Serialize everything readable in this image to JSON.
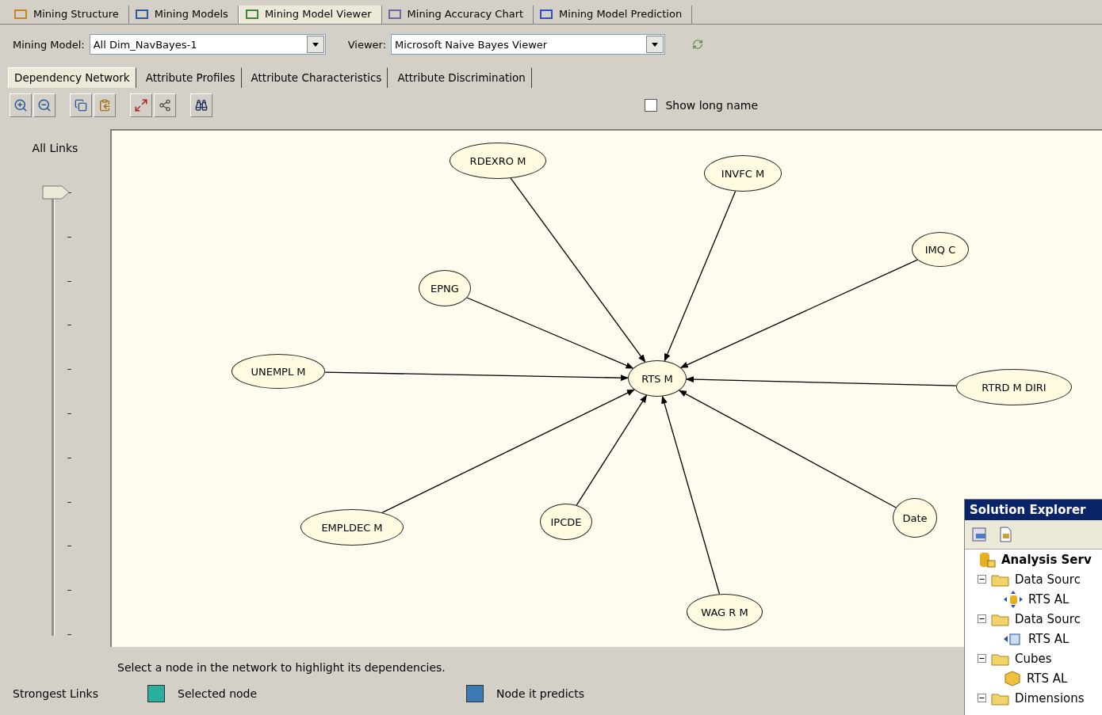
{
  "designer_tabs": [
    {
      "label": "Mining Structure",
      "selected": false
    },
    {
      "label": "Mining Models",
      "selected": false
    },
    {
      "label": "Mining Model Viewer",
      "selected": true
    },
    {
      "label": "Mining Accuracy Chart",
      "selected": false
    },
    {
      "label": "Mining Model Prediction",
      "selected": false
    }
  ],
  "mining_model": {
    "label": "Mining Model:",
    "value": "All Dim_NavBayes-1"
  },
  "viewer": {
    "label": "Viewer:",
    "value": "Microsoft Naive Bayes Viewer"
  },
  "viewer_tabs": [
    {
      "label": "Dependency Network",
      "selected": true
    },
    {
      "label": "Attribute Profiles",
      "selected": false
    },
    {
      "label": "Attribute Characteristics",
      "selected": false
    },
    {
      "label": "Attribute Discrimination",
      "selected": false
    }
  ],
  "show_long_name": {
    "label": "Show long name",
    "checked": false
  },
  "link_slider": {
    "top_label": "All Links",
    "bottom_label": "Strongest Links",
    "level": 0
  },
  "network": {
    "target": {
      "label": "RTS M"
    },
    "predictors": [
      {
        "label": "RDEXRO M"
      },
      {
        "label": "INVFC M"
      },
      {
        "label": "IMQ C"
      },
      {
        "label": "EPNG"
      },
      {
        "label": "UNEMPL M"
      },
      {
        "label": "RTRD M DIRI"
      },
      {
        "label": "EMPLDEC M"
      },
      {
        "label": "IPCDE"
      },
      {
        "label": "Date"
      },
      {
        "label": "WAG R M"
      }
    ]
  },
  "hint": "Select a node in the network to highlight its dependencies.",
  "legend": [
    {
      "label": "Selected node",
      "color": "#2aaea0"
    },
    {
      "label": "Node it predicts",
      "color": "#3b78b4"
    }
  ],
  "solution_explorer": {
    "title": "Solution Explorer",
    "tree": [
      {
        "label": "Analysis Serv",
        "kind": "project",
        "children": [
          {
            "label": "Data Sourc",
            "kind": "folder",
            "expanded": true,
            "children": [
              {
                "label": "RTS AL",
                "kind": "datasource"
              }
            ]
          },
          {
            "label": "Data Sourc",
            "kind": "folder",
            "expanded": true,
            "children": [
              {
                "label": "RTS AL",
                "kind": "view"
              }
            ]
          },
          {
            "label": "Cubes",
            "kind": "folder",
            "expanded": true,
            "children": [
              {
                "label": "RTS AL",
                "kind": "cube"
              }
            ]
          },
          {
            "label": "Dimensions",
            "kind": "folder",
            "expanded": true
          }
        ]
      }
    ]
  }
}
